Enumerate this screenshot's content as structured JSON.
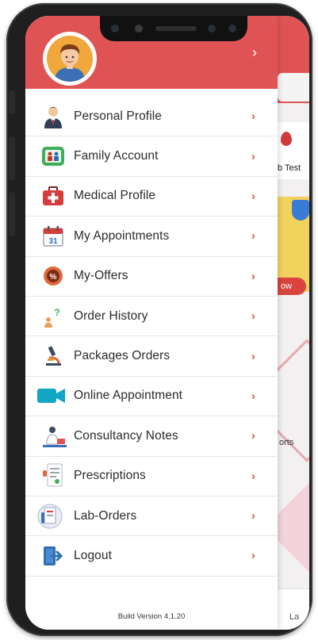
{
  "drawer": {
    "header_chevron": "›",
    "menu": [
      {
        "label": "Personal Profile",
        "icon": "doctor-icon"
      },
      {
        "label": "Family Account",
        "icon": "family-icon"
      },
      {
        "label": "Medical Profile",
        "icon": "first-aid-kit-icon"
      },
      {
        "label": "My Appointments",
        "icon": "calendar-icon"
      },
      {
        "label": "My-Offers",
        "icon": "percent-badge-icon"
      },
      {
        "label": "Order History",
        "icon": "question-person-icon"
      },
      {
        "label": "Packages Orders",
        "icon": "microscope-icon"
      },
      {
        "label": "Online Appointment",
        "icon": "video-camera-icon"
      },
      {
        "label": "Consultancy Notes",
        "icon": "doctor-notes-icon"
      },
      {
        "label": "Prescriptions",
        "icon": "prescription-icon"
      },
      {
        "label": "Lab-Orders",
        "icon": "lab-report-icon"
      },
      {
        "label": "Logout",
        "icon": "logout-icon"
      }
    ],
    "chevron": "›",
    "build_version": "Build Version 4.1.20"
  },
  "background": {
    "lab_test": "b Test",
    "now": "ow",
    "reports": "orts",
    "lab": "La"
  },
  "colors": {
    "brand_red": "#e05355",
    "chevron_red": "#e05355"
  }
}
